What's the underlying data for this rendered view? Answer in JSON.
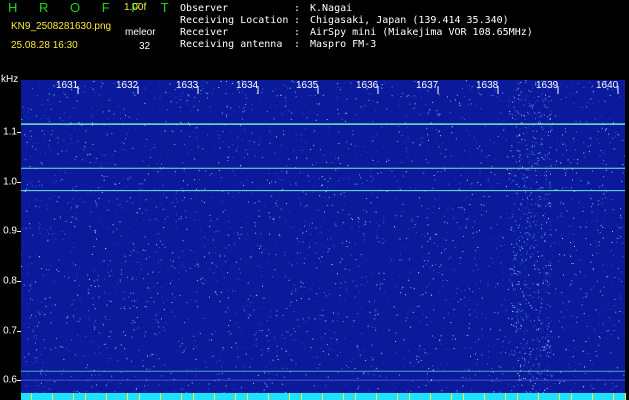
{
  "app": {
    "brand": "H R O F F T",
    "version": "1.00f",
    "filename": "KN9_2508281630.png",
    "datetime": "25.08.28 16:30",
    "mode": "meleor",
    "count": "32"
  },
  "info": [
    {
      "label": "Observer",
      "value": "K.Nagai"
    },
    {
      "label": "Receiving Location",
      "value": "Chigasaki, Japan (139.414 35.340)"
    },
    {
      "label": "Receiver",
      "value": "AirSpy mini (Miakejima VOR 108.65MHz)"
    },
    {
      "label": "Receiving antenna",
      "value": "Maspro FM-3"
    }
  ],
  "separator": ":",
  "colors": {
    "background": "#000000",
    "spectrogram_base": "#0b1a9a",
    "noise": "#5fa8ff",
    "signal": "#7fffd4",
    "brand": "#19d619",
    "meta": "#ffeb3b",
    "bottom_bar": "#1ee2ff"
  },
  "chart_data": {
    "type": "heatmap",
    "xlabel": "",
    "ylabel": "kHz",
    "x_ticks": [
      "1631",
      "1632",
      "1633",
      "1634",
      "1635",
      "1636",
      "1637",
      "1638",
      "1639",
      "1640"
    ],
    "y_ticks": [
      "1.1",
      "1.0",
      "0.9",
      "0.8",
      "0.7",
      "0.6"
    ],
    "ylim": [
      0.57,
      1.205
    ],
    "signal_lines_khz": [
      1.116,
      1.027,
      0.982,
      0.618
    ],
    "faint_lines_khz": [
      0.6
    ],
    "grid": false
  }
}
